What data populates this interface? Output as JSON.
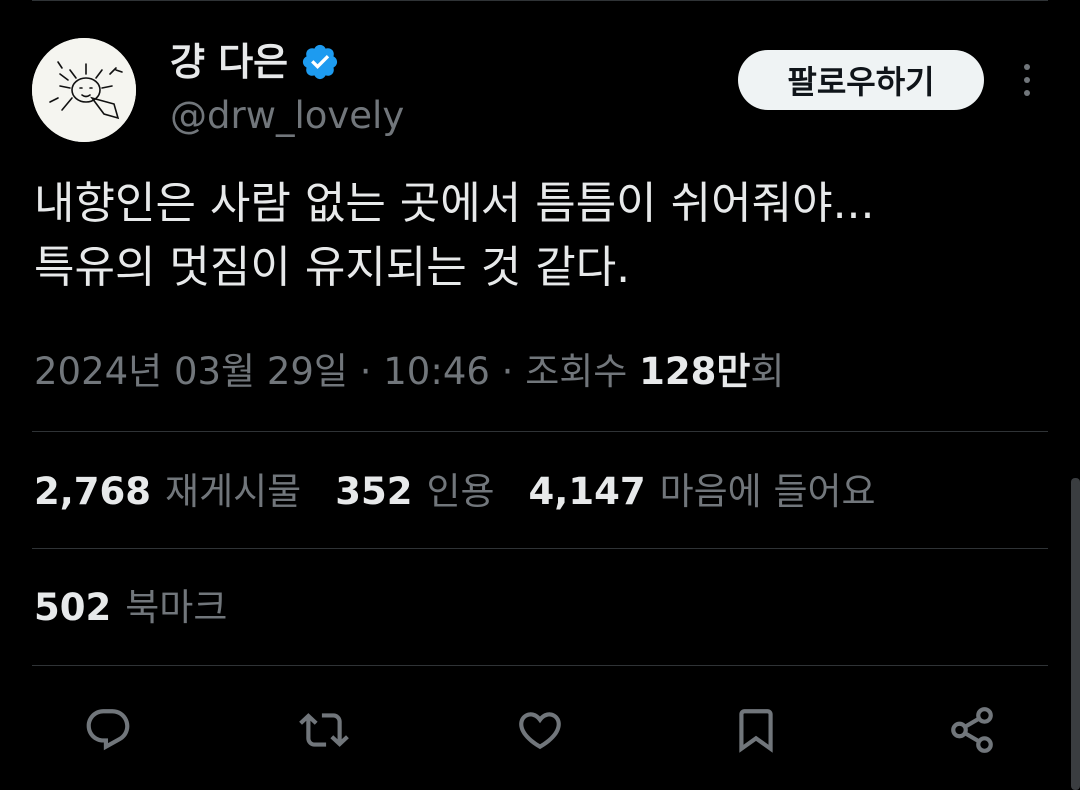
{
  "author": {
    "display_name": "걍 다은",
    "handle": "@drw_lovely",
    "verified": true,
    "verified_color": "#1d9bf0"
  },
  "header": {
    "follow_label": "팔로우하기",
    "more_icon": "more-vertical-icon"
  },
  "tweet": {
    "lines": [
      "내향인은 사람 없는 곳에서 틈틈이 쉬어줘야...",
      "특유의 멋짐이 유지되는 것 같다."
    ]
  },
  "meta": {
    "date": "2024년 03월 29일",
    "sep1": " · ",
    "time": "10:46",
    "sep2": " · ",
    "views_label_pre": "조회수 ",
    "views_number": "128만",
    "views_label_post": "회"
  },
  "stats": [
    {
      "value": "2,768",
      "label": "재게시물"
    },
    {
      "value": "352",
      "label": "인용"
    },
    {
      "value": "4,147",
      "label": "마음에 들어요"
    }
  ],
  "bookmarks": {
    "value": "502",
    "label": "북마크"
  },
  "actions": [
    {
      "name": "reply",
      "icon": "reply-icon"
    },
    {
      "name": "repost",
      "icon": "repost-icon"
    },
    {
      "name": "like",
      "icon": "heart-icon"
    },
    {
      "name": "bookmark",
      "icon": "bookmark-icon"
    },
    {
      "name": "share",
      "icon": "share-icon"
    }
  ],
  "colors": {
    "background": "#000000",
    "text_primary": "#e7e9ea",
    "text_secondary": "#71767b",
    "divider": "#2f3336",
    "follow_bg": "#eff3f4"
  }
}
